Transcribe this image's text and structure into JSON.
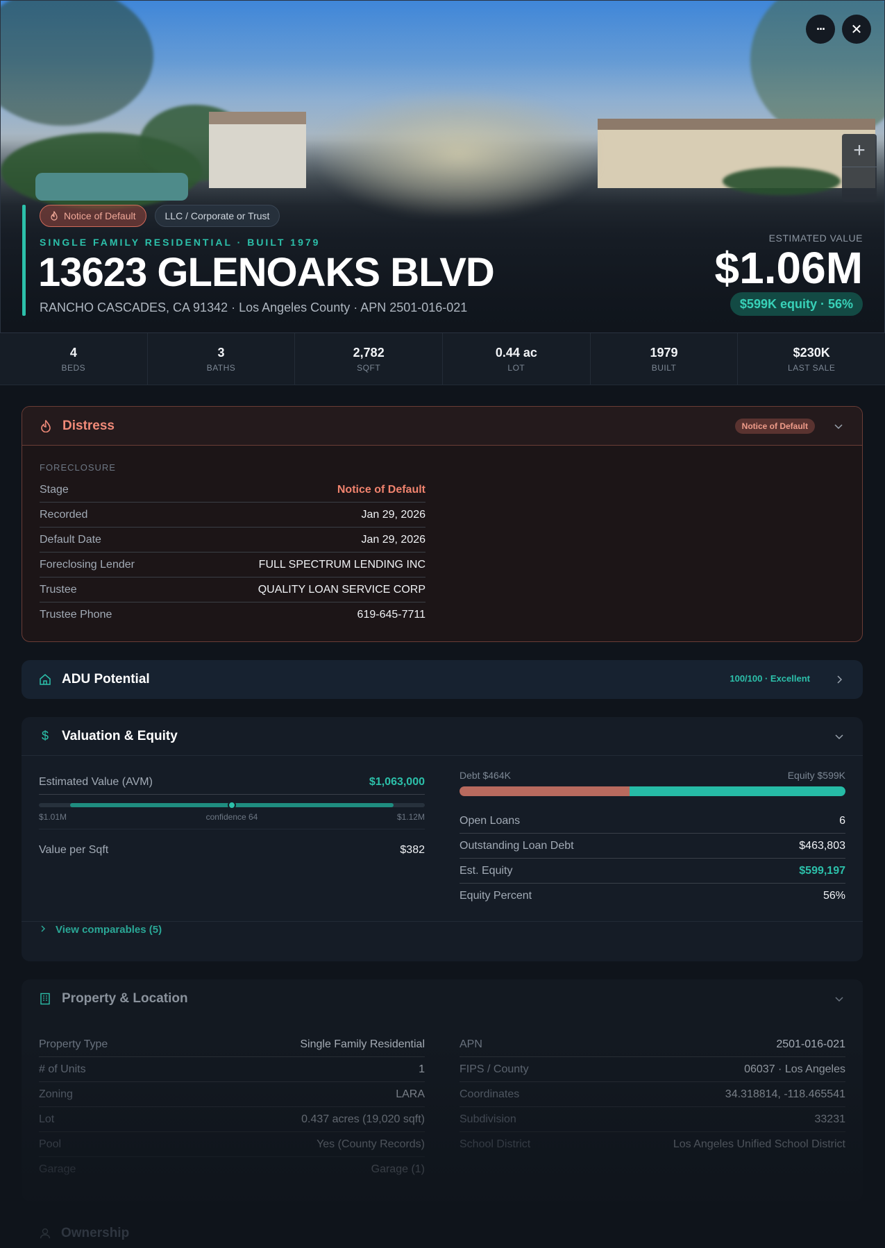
{
  "hero": {
    "badges": [
      "Notice of Default",
      "LLC / Corporate or Trust"
    ],
    "property_type_line": "SINGLE FAMILY RESIDENTIAL · BUILT 1979",
    "address": "13623 GLENOAKS BLVD",
    "subaddress": "RANCHO CASCADES, CA 91342 · Los Angeles County · APN 2501-016-021",
    "estimated_label": "ESTIMATED VALUE",
    "estimated_value": "$1.06M",
    "equity_pill": "$599K equity · 56%",
    "more_button": "···",
    "close_button": "✕",
    "zoom_in": "+"
  },
  "stats": [
    {
      "value": "4",
      "label": "BEDS"
    },
    {
      "value": "3",
      "label": "BATHS"
    },
    {
      "value": "2,782",
      "label": "SQFT"
    },
    {
      "value": "0.44 ac",
      "label": "LOT"
    },
    {
      "value": "1979",
      "label": "BUILT"
    },
    {
      "value": "$230K",
      "label": "LAST SALE"
    }
  ],
  "distress": {
    "title": "Distress",
    "badge": "Notice of Default",
    "section_label": "FORECLOSURE",
    "rows": [
      {
        "k": "Stage",
        "v": "Notice of Default"
      },
      {
        "k": "Recorded",
        "v": "Jan 29, 2026"
      },
      {
        "k": "Default Date",
        "v": "Jan 29, 2026"
      },
      {
        "k": "Foreclosing Lender",
        "v": "FULL SPECTRUM LENDING INC"
      },
      {
        "k": "Trustee",
        "v": "QUALITY LOAN SERVICE CORP"
      },
      {
        "k": "Trustee Phone",
        "v": "619-645-7711"
      }
    ],
    "colors": {
      "accent": "#f08a78",
      "border": "#6b3d36"
    }
  },
  "adu": {
    "title": "ADU Potential",
    "score": "100/100 · Excellent"
  },
  "valuation": {
    "title": "Valuation & Equity",
    "avm_label": "Estimated Value (AVM)",
    "avm_value": "$1,063,000",
    "range_low": "$1.01M",
    "range_mid": "confidence 64",
    "range_high": "$1.12M",
    "range_position": 0.5,
    "vps_label": "Value per Sqft",
    "vps_value": "$382",
    "debt_label": "Debt $464K",
    "equity_label": "Equity $599K",
    "debt_fraction": 0.44,
    "rows": [
      {
        "k": "Open Loans",
        "v": "6"
      },
      {
        "k": "Outstanding Loan Debt",
        "v": "$463,803"
      },
      {
        "k": "Est. Equity",
        "v": "$599,197"
      },
      {
        "k": "Equity Percent",
        "v": "56%"
      }
    ],
    "comparables": "View comparables (5)"
  },
  "property": {
    "title": "Property & Location",
    "left": [
      {
        "k": "Property Type",
        "v": "Single Family Residential"
      },
      {
        "k": "# of Units",
        "v": "1"
      },
      {
        "k": "Zoning",
        "v": "LARA"
      },
      {
        "k": "Lot",
        "v": "0.437 acres (19,020 sqft)"
      },
      {
        "k": "Pool",
        "v": "Yes (County Records)"
      },
      {
        "k": "Garage",
        "v": "Garage (1)"
      }
    ],
    "right": [
      {
        "k": "APN",
        "v": "2501-016-021"
      },
      {
        "k": "FIPS / County",
        "v": "06037 · Los Angeles"
      },
      {
        "k": "Coordinates",
        "v": "34.318814, -118.465541"
      },
      {
        "k": "Subdivision",
        "v": "33231"
      },
      {
        "k": "School District",
        "v": "Los Angeles Unified School District"
      }
    ]
  },
  "ownership": {
    "title": "Ownership"
  },
  "colors": {
    "teal": "#2cc0aa",
    "debt": "#b86a5e",
    "background": "#0f141b"
  }
}
